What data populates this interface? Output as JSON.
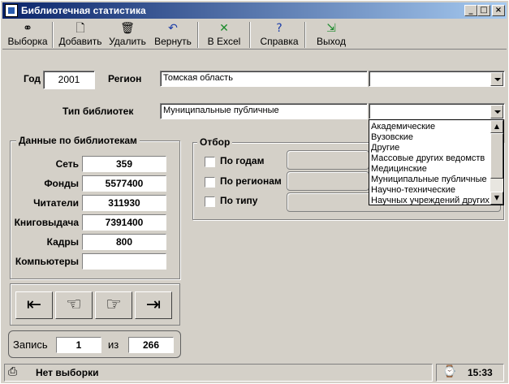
{
  "window": {
    "title": "Библиотечная статистика"
  },
  "toolbar": {
    "select": "Выборка",
    "add": "Добавить",
    "delete": "Удалить",
    "back": "Вернуть",
    "excel": "В Excel",
    "help": "Справка",
    "exit": "Выход"
  },
  "filters": {
    "year_label": "Год",
    "year_value": "2001",
    "region_label": "Регион",
    "region_value": "Томская область",
    "type_label": "Тип библиотек",
    "type_value": "Муниципальные публичные"
  },
  "data_group": {
    "title": "Данные по библиотекам",
    "rows": [
      {
        "label": "Сеть",
        "value": "359"
      },
      {
        "label": "Фонды",
        "value": "5577400"
      },
      {
        "label": "Читатели",
        "value": "311930"
      },
      {
        "label": "Книговыдача",
        "value": "7391400"
      },
      {
        "label": "Кадры",
        "value": "800"
      },
      {
        "label": "Компьютеры",
        "value": ""
      }
    ]
  },
  "selection_group": {
    "title": "Отбор",
    "by_year": "По годам",
    "by_region": "По регионам",
    "by_type": "По типу"
  },
  "dropdown": {
    "items": [
      "Академические",
      "Вузовские",
      "Другие",
      "Массовые других ведомств",
      "Медицинские",
      "Муниципальные публичные",
      "Научно-технические",
      "Научных учреждений других"
    ]
  },
  "record": {
    "label": "Запись",
    "current": "1",
    "of_label": "из",
    "total": "266"
  },
  "status": {
    "text": "Нет выборки",
    "time": "15:33"
  }
}
